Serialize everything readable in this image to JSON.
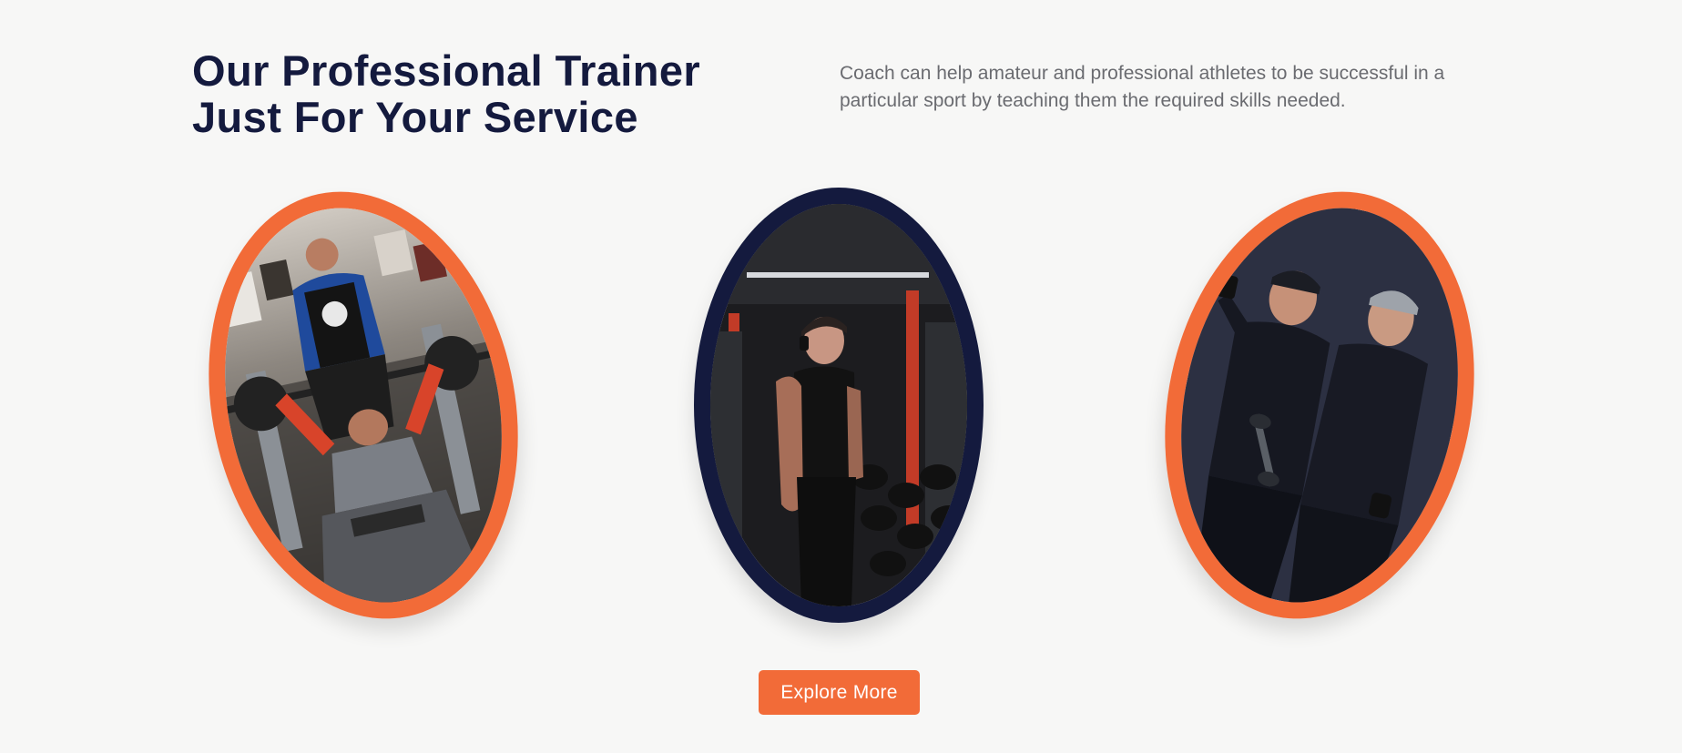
{
  "trainers_section": {
    "title_line_1": "Our Professional Trainer",
    "title_line_2": "Just For Your Service",
    "description": "Coach can help amateur and professional athletes to be successful in a particular sport by teaching them the required skills needed.",
    "cta_label": "Explore More",
    "cards": [
      {
        "frame": "orange",
        "image": "bench-press-spotting-photo"
      },
      {
        "frame": "navy",
        "image": "gym-athlete-headphones-photo"
      },
      {
        "frame": "orange",
        "image": "two-trainers-dumbbell-photo"
      }
    ]
  },
  "colors": {
    "accent": "#f26b38",
    "navy": "#141a3e",
    "background": "#f7f7f6",
    "body_text": "#6a6b70"
  }
}
